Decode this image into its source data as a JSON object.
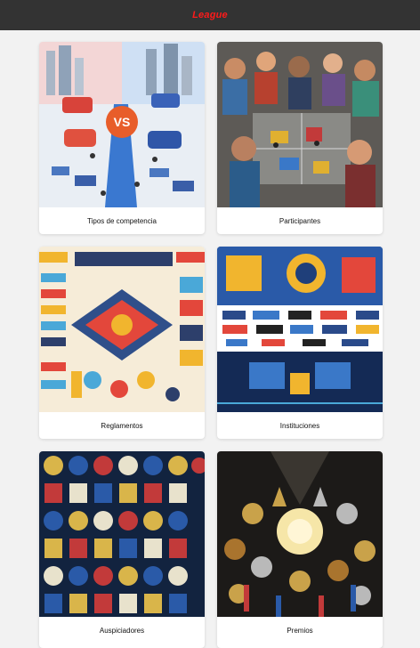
{
  "header": {
    "brand": "League",
    "brand_color": "#ff1a1a",
    "background": "#333333"
  },
  "cards": [
    {
      "label": "Tipos de competencia",
      "image": "competition-versus-illustration"
    },
    {
      "label": "Participantes",
      "image": "students-building-robots-illustration"
    },
    {
      "label": "Reglamentos",
      "image": "rules-infographic-illustration"
    },
    {
      "label": "Instituciones",
      "image": "institutions-logos-robot-arena-illustration"
    },
    {
      "label": "Auspiciadores",
      "image": "sponsor-emblems-collage"
    },
    {
      "label": "Premios",
      "image": "medals-and-trophies-illustration"
    }
  ]
}
